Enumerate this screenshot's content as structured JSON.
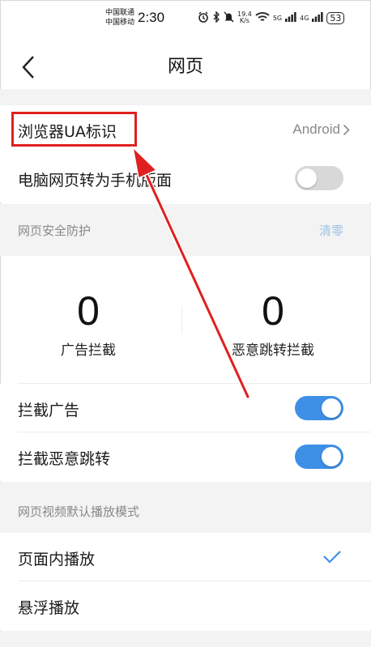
{
  "status_bar": {
    "carrier_1": "中国联通",
    "carrier_2": "中国移动",
    "time": "2:30",
    "speed_value": "19.4",
    "speed_unit": "K/s",
    "net_1": "5G",
    "net_2": "4G",
    "battery": "53"
  },
  "nav": {
    "title": "网页"
  },
  "settings": {
    "ua": {
      "label": "浏览器UA标识",
      "value": "Android"
    },
    "pc_to_mobile": {
      "label": "电脑网页转为手机版面",
      "enabled": false
    }
  },
  "security": {
    "header": "网页安全防护",
    "clear_label": "清零",
    "ads_blocked": {
      "count": "0",
      "label": "广告拦截"
    },
    "redirects_blocked": {
      "count": "0",
      "label": "恶意跳转拦截"
    },
    "block_ads": {
      "label": "拦截广告",
      "enabled": true
    },
    "block_redirects": {
      "label": "拦截恶意跳转",
      "enabled": true
    }
  },
  "video": {
    "header": "网页视频默认播放模式",
    "options": [
      {
        "label": "页面内播放",
        "selected": true
      },
      {
        "label": "悬浮播放",
        "selected": false
      }
    ]
  },
  "colors": {
    "accent": "#3e8fe6",
    "annotation": "#e02020",
    "section_bg": "#f3f3f3"
  }
}
